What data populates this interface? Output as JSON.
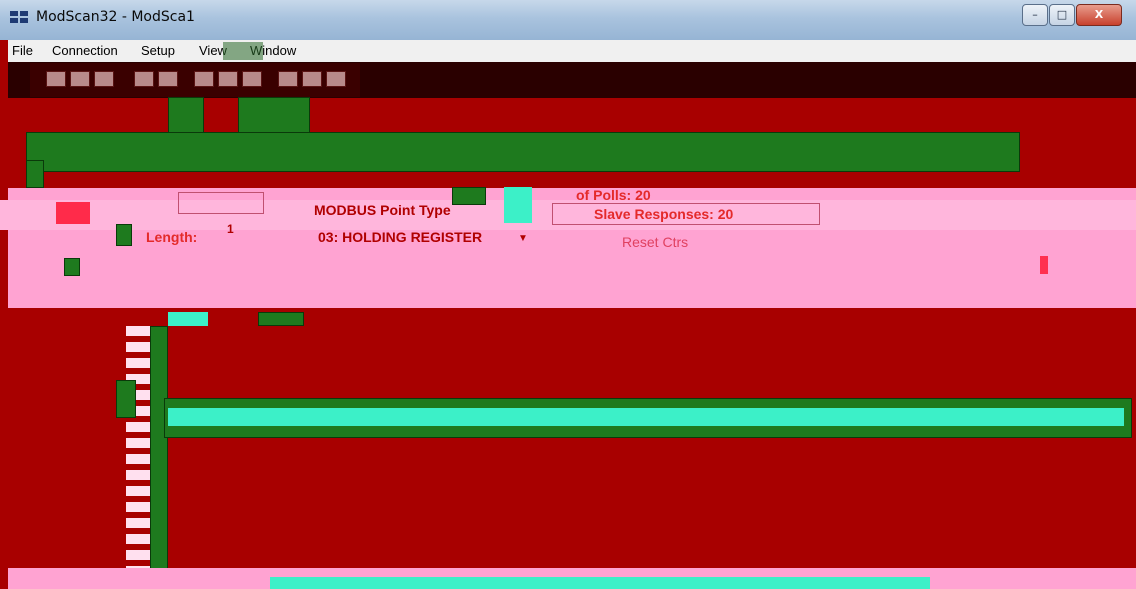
{
  "window": {
    "title": "ModScan32 - ModSca1",
    "controls": {
      "minimize": "–",
      "maximize": "□",
      "close": "X"
    }
  },
  "menu": {
    "items": [
      "File",
      "Connection",
      "Setup",
      "View",
      "Window"
    ]
  },
  "form": {
    "length_label": "Length:",
    "length_value": "1",
    "point_type_label": "MODBUS Point Type",
    "point_type_value": "03: HOLDING REGISTER",
    "polls_label": "of Polls: 20",
    "responses_label": "Slave Responses: 20",
    "reset_label": "Reset Ctrs"
  },
  "colors": {
    "background": "#a80000",
    "pink_band": "#ffa3d2",
    "green": "#1e7a1e",
    "cyan": "#3cf0c8"
  }
}
